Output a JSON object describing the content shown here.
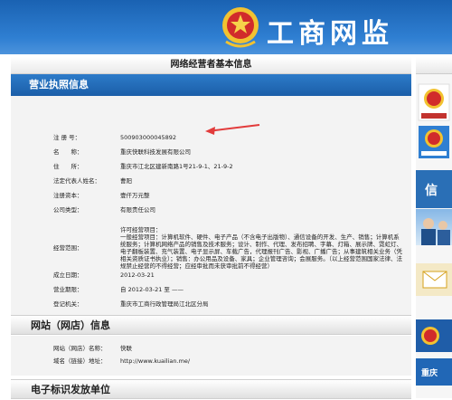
{
  "banner": {
    "title": "工商网监"
  },
  "page": {
    "header": "网络经营者基本信息"
  },
  "license": {
    "heading": "营业执照信息",
    "rows": [
      {
        "label": "注 册 号：",
        "value": "500903000045892"
      },
      {
        "label": "名　　称：",
        "value": "重庆快联科技发展有限公司"
      },
      {
        "label": "住　　所：",
        "value": "重庆市江北区建新南路1号21-9-1、21-9-2"
      },
      {
        "label": "法定代表人姓名：",
        "value": "曹阳"
      },
      {
        "label": "注册资本：",
        "value": "壹仟万元整"
      },
      {
        "label": "公司类型：",
        "value": "有限责任公司"
      },
      {
        "label": "经营范围：",
        "value": "许可经营项目：\n一般经营项目：计算机软件、硬件、电子产品（不含电子出版物）、通信设备的开发、生产、销售；计算机系统服务；计算机网络产品的销售及技术服务；设计、制作、代理、发布招聘、字幕、灯箱、展示牌、霓虹灯、电子翻板装置、充气装置、电子显示屏、车载广告，代理报刊广告、影视、广播广告；从事建筑相关业务（凭相关资质证书执业）；销售：办公用品及设备、家具；企业管理咨询；会展服务。（以上经营范围国家法律、法规禁止经营的不得经营；应经审批而未获审批前不得经营）"
      },
      {
        "label": "成立日期：",
        "value": "2012-03-21"
      },
      {
        "label": "营业期限：",
        "value": "自 2012-03-21 至 ——"
      },
      {
        "label": "登记机关：",
        "value": "重庆市工商行政管理局江北区分局"
      }
    ]
  },
  "website": {
    "heading": "网站（网店）信息",
    "rows": [
      {
        "label": "网站（网店）名称：",
        "value": "快联"
      },
      {
        "label": "域名（链接）地址：",
        "value": "http://www.kuailian.me/"
      }
    ]
  },
  "electronic": {
    "heading": "电子标识发放单位"
  },
  "sidebar": {
    "items": [
      {
        "label": "工商网监"
      },
      {
        "label": "信"
      },
      {
        "label": "重庆"
      }
    ]
  },
  "colors": {
    "banner": "#1a62b2",
    "section_head": "#2d7bc9",
    "arrow": "#e23b3b"
  }
}
